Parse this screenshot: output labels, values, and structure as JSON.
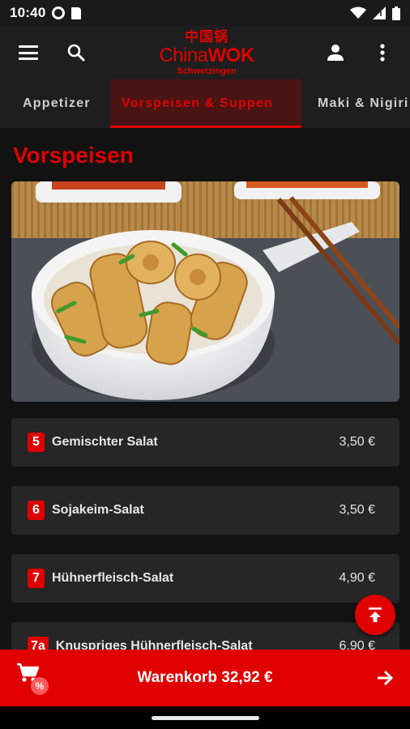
{
  "status_bar": {
    "time": "10:40",
    "icons": [
      "settings-icon",
      "sd-card-icon",
      "wifi-icon",
      "signal-icon",
      "battery-icon"
    ]
  },
  "app_bar": {
    "logo": {
      "chinese": "中国锅",
      "brand_light": "China",
      "brand_bold": "WOK",
      "city": "Schwetzingen"
    },
    "icons": [
      "menu-icon",
      "search-icon",
      "account-icon",
      "more-vert-icon"
    ]
  },
  "tabs": [
    {
      "label": "Appetizer",
      "active": false
    },
    {
      "label": "Vorspeisen & Suppen",
      "active": true
    },
    {
      "label": "Maki & Nigiri",
      "active": false
    }
  ],
  "section": {
    "title": "Vorspeisen"
  },
  "menu_items": [
    {
      "number": "5",
      "name": "Gemischter Salat",
      "price": "3,50 €"
    },
    {
      "number": "6",
      "name": "Sojakeim-Salat",
      "price": "3,50 €"
    },
    {
      "number": "7",
      "name": "Hühnerfleisch-Salat",
      "price": "4,90 €"
    },
    {
      "number": "7a",
      "name": "Knuspriges Hühnerfleisch-Salat",
      "price": "6,90 €"
    }
  ],
  "cart": {
    "label": "Warenkorb 32,92 €",
    "badge": "%"
  },
  "colors": {
    "accent": "#e00000",
    "background": "#121212",
    "card": "#262626"
  }
}
